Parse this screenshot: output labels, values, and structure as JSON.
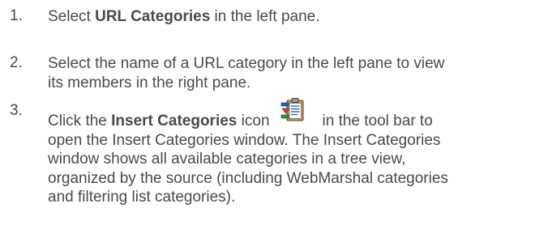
{
  "steps": [
    {
      "number": "1.",
      "text_before": "Select ",
      "bold": "URL Categories",
      "text_after": " in the left pane."
    },
    {
      "number": "2.",
      "line1": "Select the name of a URL category in the left pane to view",
      "line2": "its members in the right pane."
    },
    {
      "number": "3.",
      "line1_before": "Click the ",
      "line1_bold": "Insert Categories",
      "line1_mid": " icon",
      "line1_after": "in the tool bar to",
      "line2": "open the Insert Categories window. The Insert Categories",
      "line3": "window shows all available categories in a tree view,",
      "line4": "organized by the source (including WebMarshal categories",
      "line5": "and filtering list categories).",
      "icon": "insert-categories-icon"
    }
  ]
}
